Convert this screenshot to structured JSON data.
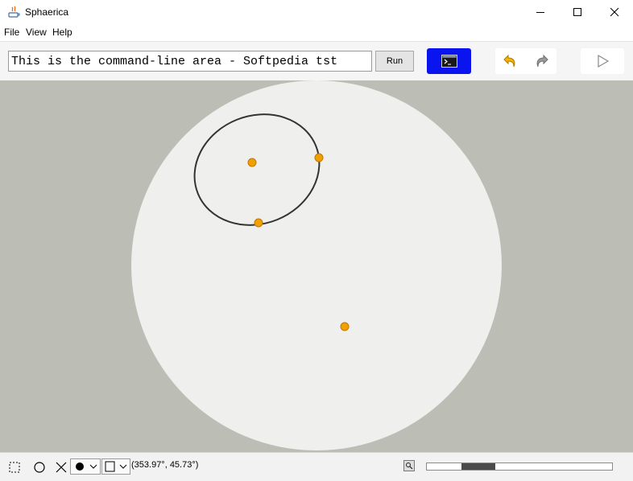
{
  "window": {
    "title": "Sphaerica",
    "controls": [
      "minimize",
      "maximize",
      "close"
    ]
  },
  "menu": {
    "items": [
      "File",
      "View",
      "Help"
    ]
  },
  "toolbar": {
    "command_value": "This is the command-line area - Softpedia tst",
    "run_label": "Run",
    "console_icon": "terminal-icon",
    "undo_icon": "undo-icon",
    "redo_icon": "redo-icon",
    "play_icon": "play-icon",
    "colors": {
      "console_bg": "#0a14ee",
      "undo": "#e8a400",
      "redo": "#8a8a8a"
    }
  },
  "canvas": {
    "background": "#bcbeb6",
    "sphere_fill": "#efefee",
    "point_color": "#f0a000",
    "curve_color": "#333333"
  },
  "status": {
    "tools": [
      "select-rect-icon",
      "circle-icon",
      "cross-icon"
    ],
    "fill_style": "filled-dot",
    "shape_style": "square-outline",
    "coordinates": "(353.97°, 45.73°)",
    "zoom_level": 0.23
  }
}
